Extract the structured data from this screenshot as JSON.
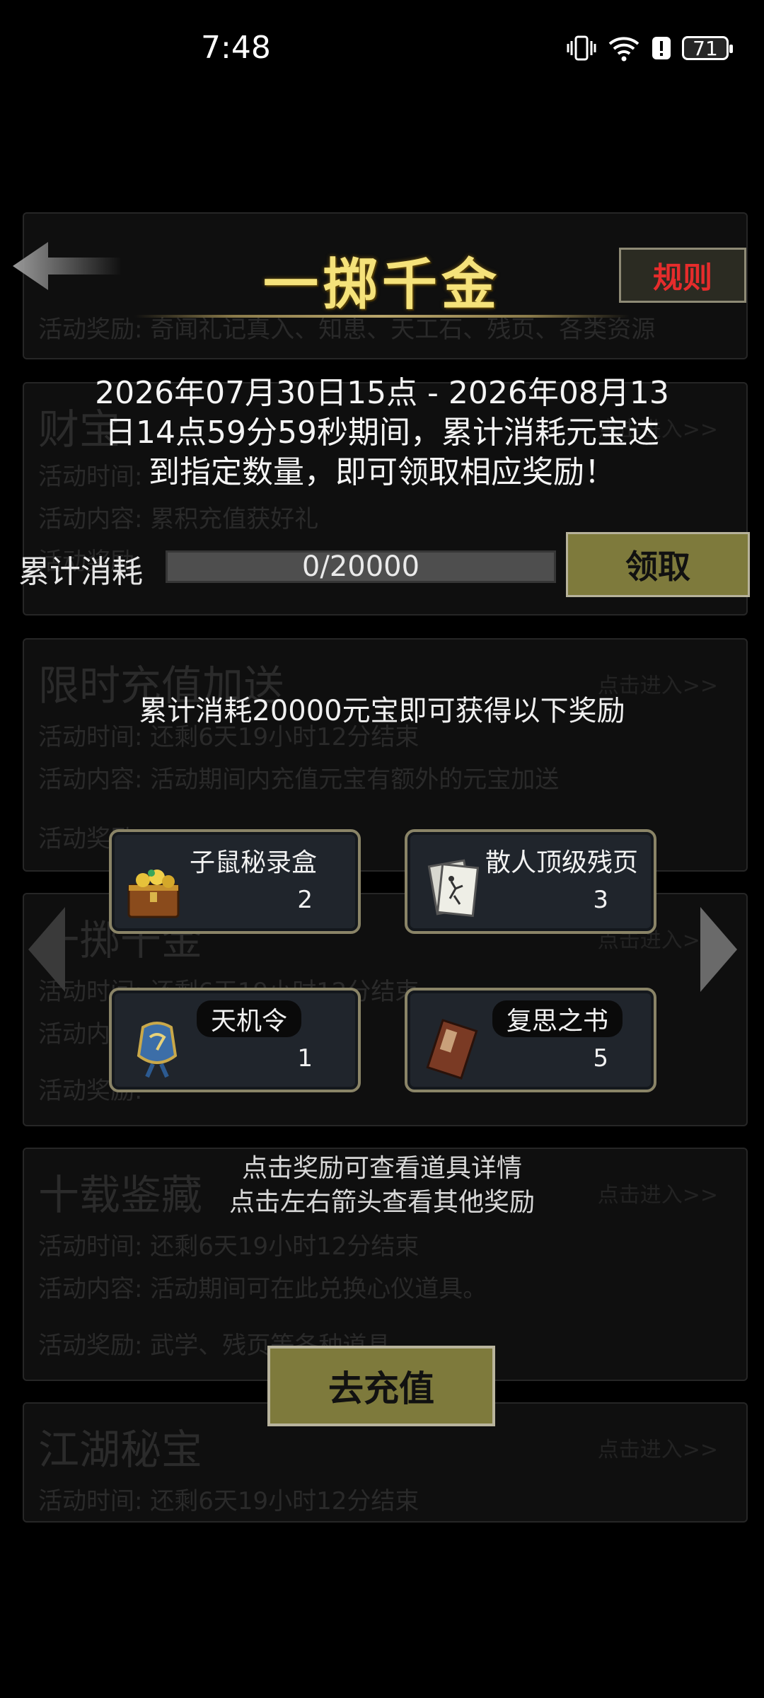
{
  "status_bar": {
    "time": "7:48",
    "battery": "71"
  },
  "background_list": [
    {
      "title": "",
      "lines": [
        "活动奖励: 奇闻礼记真入、知患、天工石、残页、各类资源"
      ],
      "enter": ""
    },
    {
      "title": "财宝",
      "lines": [
        "活动时间: ",
        "活动内容: 累积充值获好礼",
        "活动奖励: "
      ],
      "enter": "点击进入>>"
    },
    {
      "title": "限时充值加送",
      "lines": [
        "活动时间: 还剩6天19小时12分结束",
        "活动内容: 活动期间内充值元宝有额外的元宝加送",
        "活动奖励: "
      ],
      "enter": "点击进入>>"
    },
    {
      "title": "一掷千金",
      "lines": [
        "活动时间: 还剩6天19小时12分结束",
        "活动内容: ",
        "活动奖励: "
      ],
      "enter": "点击进入>>"
    },
    {
      "title": "十载鉴藏",
      "lines": [
        "活动时间: 还剩6天19小时12分结束",
        "活动内容: 活动期间可在此兑换心仪道具。",
        "活动奖励: 武学、残页等各种道具"
      ],
      "enter": "点击进入>>"
    },
    {
      "title": "江湖秘宝",
      "lines": [
        "活动时间: 还剩6天19小时12分结束"
      ],
      "enter": "点击进入>>"
    }
  ],
  "header": {
    "title": "一掷千金",
    "rules_label": "规则"
  },
  "description": {
    "line1": "2026年07月30日15点 - 2026年08月13",
    "line2": "日14点59分59秒期间，累计消耗元宝达",
    "line3": "到指定数量，即可领取相应奖励！"
  },
  "progress": {
    "label": "累计消耗",
    "text": "0/20000",
    "current": 0,
    "target": 20000,
    "claim_label": "领取"
  },
  "rewards": {
    "title": "累计消耗20000元宝即可获得以下奖励",
    "items": [
      {
        "name": "子鼠秘录盒",
        "count": "2",
        "icon": "treasure-chest-icon"
      },
      {
        "name": "散人顶级残页",
        "count": "3",
        "icon": "scroll-page-icon"
      },
      {
        "name": "天机令",
        "count": "1",
        "icon": "token-medal-icon"
      },
      {
        "name": "复思之书",
        "count": "5",
        "icon": "book-icon"
      }
    ]
  },
  "hints": {
    "line1": "点击奖励可查看道具详情",
    "line2": "点击左右箭头查看其他奖励"
  },
  "recharge_label": "去充值",
  "colors": {
    "gold_title": "#f5e27a",
    "button_olive": "#7e7a3c",
    "rules_red": "#e62c2c"
  }
}
